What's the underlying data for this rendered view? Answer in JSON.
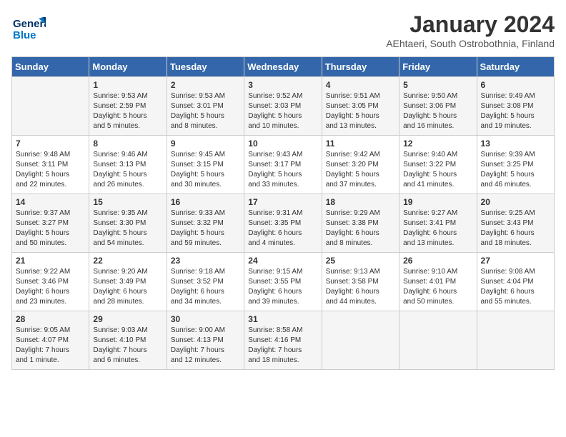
{
  "logo": {
    "line1": "General",
    "line2": "Blue"
  },
  "title": "January 2024",
  "subtitle": "AEhtaeri, South Ostrobothnia, Finland",
  "weekdays": [
    "Sunday",
    "Monday",
    "Tuesday",
    "Wednesday",
    "Thursday",
    "Friday",
    "Saturday"
  ],
  "weeks": [
    [
      {
        "day": "",
        "info": ""
      },
      {
        "day": "1",
        "info": "Sunrise: 9:53 AM\nSunset: 2:59 PM\nDaylight: 5 hours\nand 5 minutes."
      },
      {
        "day": "2",
        "info": "Sunrise: 9:53 AM\nSunset: 3:01 PM\nDaylight: 5 hours\nand 8 minutes."
      },
      {
        "day": "3",
        "info": "Sunrise: 9:52 AM\nSunset: 3:03 PM\nDaylight: 5 hours\nand 10 minutes."
      },
      {
        "day": "4",
        "info": "Sunrise: 9:51 AM\nSunset: 3:05 PM\nDaylight: 5 hours\nand 13 minutes."
      },
      {
        "day": "5",
        "info": "Sunrise: 9:50 AM\nSunset: 3:06 PM\nDaylight: 5 hours\nand 16 minutes."
      },
      {
        "day": "6",
        "info": "Sunrise: 9:49 AM\nSunset: 3:08 PM\nDaylight: 5 hours\nand 19 minutes."
      }
    ],
    [
      {
        "day": "7",
        "info": "Sunrise: 9:48 AM\nSunset: 3:11 PM\nDaylight: 5 hours\nand 22 minutes."
      },
      {
        "day": "8",
        "info": "Sunrise: 9:46 AM\nSunset: 3:13 PM\nDaylight: 5 hours\nand 26 minutes."
      },
      {
        "day": "9",
        "info": "Sunrise: 9:45 AM\nSunset: 3:15 PM\nDaylight: 5 hours\nand 30 minutes."
      },
      {
        "day": "10",
        "info": "Sunrise: 9:43 AM\nSunset: 3:17 PM\nDaylight: 5 hours\nand 33 minutes."
      },
      {
        "day": "11",
        "info": "Sunrise: 9:42 AM\nSunset: 3:20 PM\nDaylight: 5 hours\nand 37 minutes."
      },
      {
        "day": "12",
        "info": "Sunrise: 9:40 AM\nSunset: 3:22 PM\nDaylight: 5 hours\nand 41 minutes."
      },
      {
        "day": "13",
        "info": "Sunrise: 9:39 AM\nSunset: 3:25 PM\nDaylight: 5 hours\nand 46 minutes."
      }
    ],
    [
      {
        "day": "14",
        "info": "Sunrise: 9:37 AM\nSunset: 3:27 PM\nDaylight: 5 hours\nand 50 minutes."
      },
      {
        "day": "15",
        "info": "Sunrise: 9:35 AM\nSunset: 3:30 PM\nDaylight: 5 hours\nand 54 minutes."
      },
      {
        "day": "16",
        "info": "Sunrise: 9:33 AM\nSunset: 3:32 PM\nDaylight: 5 hours\nand 59 minutes."
      },
      {
        "day": "17",
        "info": "Sunrise: 9:31 AM\nSunset: 3:35 PM\nDaylight: 6 hours\nand 4 minutes."
      },
      {
        "day": "18",
        "info": "Sunrise: 9:29 AM\nSunset: 3:38 PM\nDaylight: 6 hours\nand 8 minutes."
      },
      {
        "day": "19",
        "info": "Sunrise: 9:27 AM\nSunset: 3:41 PM\nDaylight: 6 hours\nand 13 minutes."
      },
      {
        "day": "20",
        "info": "Sunrise: 9:25 AM\nSunset: 3:43 PM\nDaylight: 6 hours\nand 18 minutes."
      }
    ],
    [
      {
        "day": "21",
        "info": "Sunrise: 9:22 AM\nSunset: 3:46 PM\nDaylight: 6 hours\nand 23 minutes."
      },
      {
        "day": "22",
        "info": "Sunrise: 9:20 AM\nSunset: 3:49 PM\nDaylight: 6 hours\nand 28 minutes."
      },
      {
        "day": "23",
        "info": "Sunrise: 9:18 AM\nSunset: 3:52 PM\nDaylight: 6 hours\nand 34 minutes."
      },
      {
        "day": "24",
        "info": "Sunrise: 9:15 AM\nSunset: 3:55 PM\nDaylight: 6 hours\nand 39 minutes."
      },
      {
        "day": "25",
        "info": "Sunrise: 9:13 AM\nSunset: 3:58 PM\nDaylight: 6 hours\nand 44 minutes."
      },
      {
        "day": "26",
        "info": "Sunrise: 9:10 AM\nSunset: 4:01 PM\nDaylight: 6 hours\nand 50 minutes."
      },
      {
        "day": "27",
        "info": "Sunrise: 9:08 AM\nSunset: 4:04 PM\nDaylight: 6 hours\nand 55 minutes."
      }
    ],
    [
      {
        "day": "28",
        "info": "Sunrise: 9:05 AM\nSunset: 4:07 PM\nDaylight: 7 hours\nand 1 minute."
      },
      {
        "day": "29",
        "info": "Sunrise: 9:03 AM\nSunset: 4:10 PM\nDaylight: 7 hours\nand 6 minutes."
      },
      {
        "day": "30",
        "info": "Sunrise: 9:00 AM\nSunset: 4:13 PM\nDaylight: 7 hours\nand 12 minutes."
      },
      {
        "day": "31",
        "info": "Sunrise: 8:58 AM\nSunset: 4:16 PM\nDaylight: 7 hours\nand 18 minutes."
      },
      {
        "day": "",
        "info": ""
      },
      {
        "day": "",
        "info": ""
      },
      {
        "day": "",
        "info": ""
      }
    ]
  ]
}
